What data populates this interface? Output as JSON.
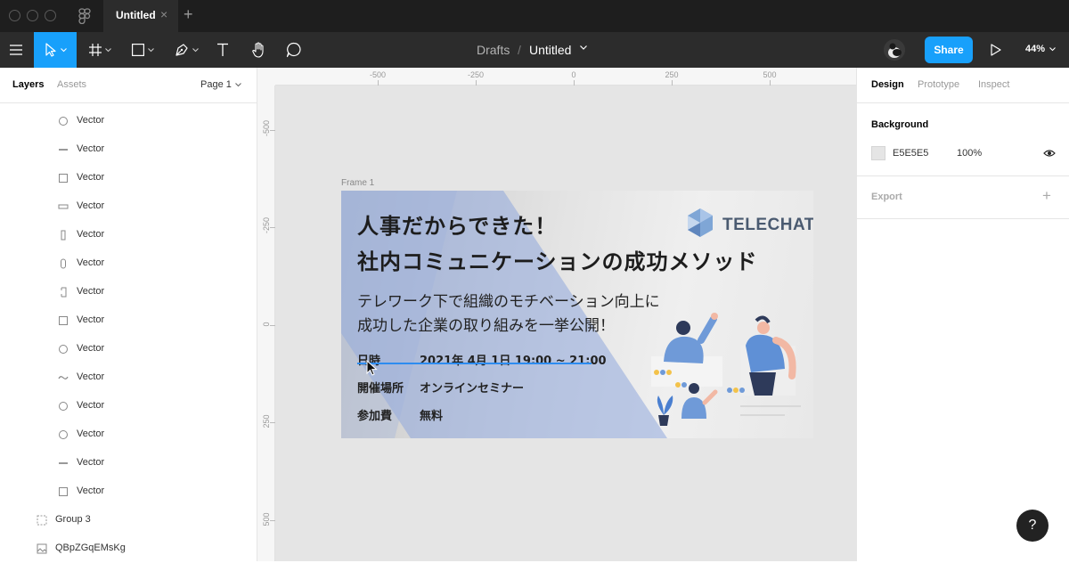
{
  "titlebar": {
    "tab_title": "Untitled",
    "tab_close": "×",
    "tab_add": "+"
  },
  "toolbar": {
    "tools": [
      "main-menu",
      "move",
      "frame",
      "shape",
      "pen",
      "text",
      "hand",
      "comment"
    ],
    "active_tool": "move",
    "breadcrumb_drafts": "Drafts",
    "breadcrumb_sep": "/",
    "file_title": "Untitled",
    "share_label": "Share",
    "zoom": "44%",
    "accent": "#18A0FB"
  },
  "left_panel": {
    "tab_layers": "Layers",
    "tab_assets": "Assets",
    "page_selector": "Page 1",
    "layers": [
      {
        "name": "Vector",
        "icon": "ellipse-icon"
      },
      {
        "name": "Vector",
        "icon": "line-icon"
      },
      {
        "name": "Vector",
        "icon": "rectangle-icon"
      },
      {
        "name": "Vector",
        "icon": "thin-rectangle-icon"
      },
      {
        "name": "Vector",
        "icon": "narrow-rectangle-icon"
      },
      {
        "name": "Vector",
        "icon": "rounded-rectangle-icon"
      },
      {
        "name": "Vector",
        "icon": "bracket-rectangle-icon"
      },
      {
        "name": "Vector",
        "icon": "rectangle-icon"
      },
      {
        "name": "Vector",
        "icon": "ellipse-icon"
      },
      {
        "name": "Vector",
        "icon": "path-icon"
      },
      {
        "name": "Vector",
        "icon": "ellipse-icon"
      },
      {
        "name": "Vector",
        "icon": "ellipse-icon"
      },
      {
        "name": "Vector",
        "icon": "line-icon"
      },
      {
        "name": "Vector",
        "icon": "rectangle-icon"
      },
      {
        "name": "Group 3",
        "icon": "group-icon"
      },
      {
        "name": "QBpZGqEMsKg",
        "icon": "image-icon"
      }
    ]
  },
  "canvas": {
    "background": "#E5E5E5",
    "ruler_top": [
      "-500",
      "-250",
      "0",
      "250",
      "500"
    ],
    "ruler_left": [
      "-500",
      "-250",
      "0",
      "250",
      "500"
    ],
    "frame_label": "Frame 1",
    "banner": {
      "headline_1": "人事だからできた！",
      "headline_2": "社内コミュニケーションの成功メソッド",
      "sub_1": "テレワーク下で組織のモチベーション向上に",
      "sub_2": "成功した企業の取り組みを一挙公開！",
      "rows": [
        {
          "key": "日時",
          "value": "2021年 4月 1日 19:00 ~ 21:00"
        },
        {
          "key": "開催場所",
          "value": "オンラインセミナー"
        },
        {
          "key": "参加費",
          "value": "無料"
        }
      ],
      "brand": "TELECHAT",
      "brand_color": "#4A5A70",
      "shape_color": "#8FA8DC"
    }
  },
  "right_panel": {
    "tab_design": "Design",
    "tab_prototype": "Prototype",
    "tab_inspect": "Inspect",
    "background_heading": "Background",
    "background_hex": "E5E5E5",
    "background_opacity": "100%",
    "export_heading": "Export",
    "export_add": "+"
  },
  "help_label": "?"
}
